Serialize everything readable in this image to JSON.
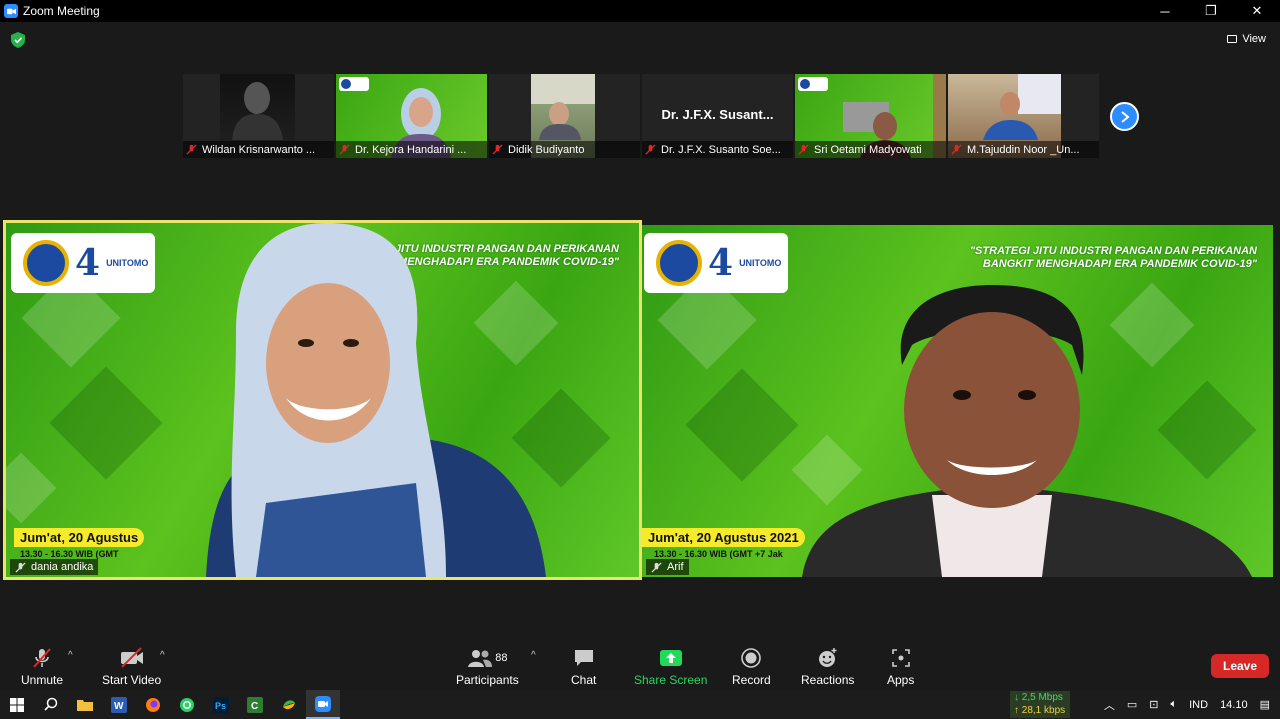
{
  "window": {
    "title": "Zoom Meeting",
    "minimize": "─",
    "restore": "❐",
    "close": "✕"
  },
  "view_button": {
    "label": "View"
  },
  "thumbnails": [
    {
      "name": "Wildan Krisnarwanto ..."
    },
    {
      "name": "Dr. Kejora Handarini ..."
    },
    {
      "name": "Didik Budiyanto"
    },
    {
      "name": "Dr. J.F.X. Susanto Soe...",
      "display_text": "Dr. J.F.X. Susant..."
    },
    {
      "name": "Sri Oetami Madyowati"
    },
    {
      "name": "M.Tajuddin Noor _Un..."
    }
  ],
  "video_tiles": [
    {
      "name": "dania andika",
      "banner_title_line1": "STRATEGI JITU INDUSTRI PANGAN DAN PERIKANAN",
      "banner_title_line2": "BANGKIT MENGHADAPI ERA PANDEMIK COVID-19\"",
      "date": "Jum'at, 20 Agustus",
      "time": "13.30 - 16.30 WIB (GMT"
    },
    {
      "name": "Arif",
      "banner_title_line1": "\"STRATEGI JITU INDUSTRI PANGAN DAN PERIKANAN",
      "banner_title_line2": "BANGKIT MENGHADAPI ERA PANDEMIK COVID-19\"",
      "date": "Jum'at, 20 Agustus 2021",
      "time": "13.30 - 16.30 WIB (GMT +7 Jak"
    }
  ],
  "logo_text": "UNITOMO",
  "toolbar": {
    "unmute": "Unmute",
    "start_video": "Start Video",
    "participants": "Participants",
    "participants_count": "88",
    "chat": "Chat",
    "share_screen": "Share Screen",
    "record": "Record",
    "reactions": "Reactions",
    "apps": "Apps",
    "leave": "Leave"
  },
  "taskbar": {
    "net_down": "2,5 Mbps",
    "net_up": "28,1 kbps",
    "lang": "IND",
    "time": "14.10"
  },
  "colors": {
    "accent": "#2d8cff",
    "leave": "#d72828",
    "share_green": "#23d959",
    "active_border": "#e8e56a"
  }
}
